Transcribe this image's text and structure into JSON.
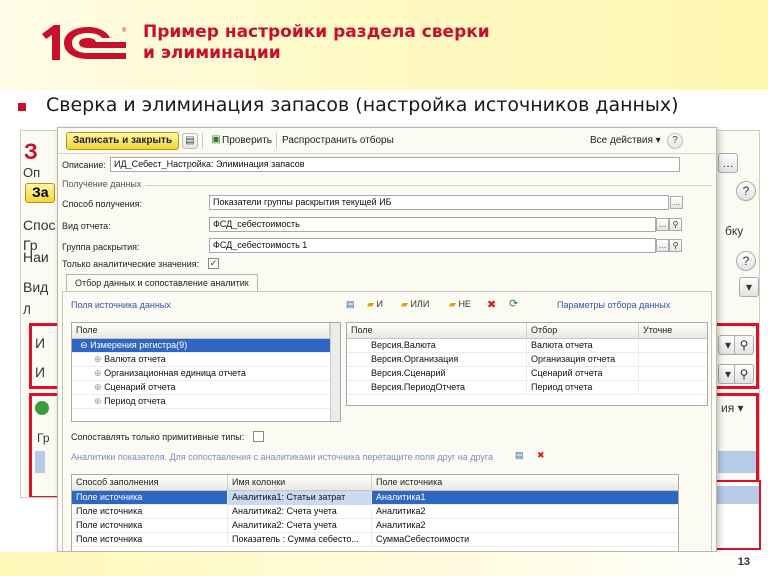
{
  "slide": {
    "title_line1": "Пример настройки раздела сверки",
    "title_line2": "и элиминации",
    "subtitle": "Сверка и элиминация запасов (настройка источников данных)",
    "page_number": "13",
    "brand_color": "#c8102e"
  },
  "background_form": {
    "title": "З",
    "labels": [
      "Оп",
      "За",
      "Спос",
      "Гр",
      "Наи",
      "Вид",
      "И",
      "И",
      "Л",
      "бку",
      "Гр"
    ],
    "dropdown_tail": "ия ▾"
  },
  "dialog": {
    "toolbar": {
      "save_close": "Записать и закрыть",
      "check": "Проверить",
      "spread": "Распространить отборы",
      "all_actions": "Все действия ▾",
      "help": "?"
    },
    "description_label": "Описание:",
    "description_value": "ИД_Себест_Настройка: Элиминация запасов",
    "group_obtain": "Получение данных",
    "fields": {
      "method_label": "Способ получения:",
      "method_value": "Показатели группы раскрытия текущей ИБ",
      "report_type_label": "Вид отчета:",
      "report_type_value": "ФСД_себестоимость",
      "group_label": "Группа раскрытия:",
      "group_value": "ФСД_себестоимость 1",
      "analytic_only_label": "Только аналитические значения:"
    },
    "tab_label": "Отбор данных и сопоставление аналитик",
    "source_fields_link": "Поля источника данных",
    "filter_buttons": {
      "and": "И",
      "or": "ИЛИ",
      "not": "НЕ"
    },
    "filter_params_link": "Параметры отбора данных",
    "field_tree": {
      "header": "Поле",
      "root": "Измерения регистра(9)",
      "items": [
        "Валюта отчета",
        "Организационная единица отчета",
        "Сценарий отчета",
        "Период отчета"
      ]
    },
    "filter_table": {
      "headers": [
        "Поле",
        "Отбор",
        "Уточне"
      ],
      "rows": [
        [
          "Версия.Валюта",
          "Валюта отчета"
        ],
        [
          "Версия.Организация",
          "Организация отчета"
        ],
        [
          "Версия.Сценарий",
          "Сценарий отчета"
        ],
        [
          "Версия.ПериодОтчета",
          "Период отчета"
        ]
      ]
    },
    "primitive_types_label": "Сопоставлять только примитивные типы:",
    "analytics_hint": "Аналитики показателя. Для сопоставления с аналитиками источника перетащите поля друг на друга",
    "mapping_table": {
      "headers": [
        "Способ заполнения",
        "Имя колонки",
        "Поле источника"
      ],
      "rows": [
        [
          "Поле источника",
          "Аналитика1: Статьи затрат",
          "Аналитика1"
        ],
        [
          "Поле источника",
          "Аналитика2: Счета учета",
          "Аналитика2"
        ],
        [
          "Поле источника",
          "Аналитика2: Счета учета",
          "Аналитика2"
        ],
        [
          "Поле источника",
          "Показатель : Сумма себесто...",
          "СуммаСебестоимости"
        ]
      ]
    }
  }
}
